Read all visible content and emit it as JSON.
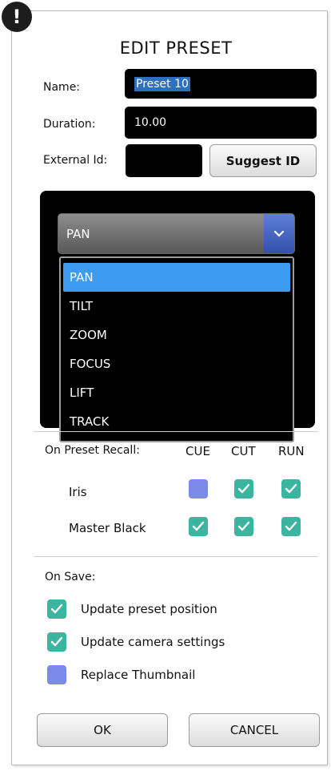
{
  "dialog": {
    "title": "EDIT PRESET",
    "alert_glyph": "!"
  },
  "form": {
    "name_label": "Name:",
    "name_value": "Preset 10",
    "duration_label": "Duration:",
    "duration_value": "10.00",
    "external_id_label": "External Id:",
    "external_id_value": "",
    "suggest_id_label": "Suggest ID"
  },
  "axis_select": {
    "selected": "PAN",
    "options": [
      "PAN",
      "TILT",
      "ZOOM",
      "FOCUS",
      "LIFT",
      "TRACK"
    ]
  },
  "recall": {
    "label": "On Preset Recall:",
    "columns": [
      "CUE",
      "CUT",
      "RUN"
    ],
    "rows": [
      {
        "label": "Iris",
        "values": [
          false,
          true,
          true
        ]
      },
      {
        "label": "Master Black",
        "values": [
          true,
          true,
          true
        ]
      }
    ]
  },
  "save": {
    "label": "On Save:",
    "options": [
      {
        "label": "Update preset position",
        "checked": true
      },
      {
        "label": "Update camera settings",
        "checked": true
      },
      {
        "label": "Replace Thumbnail",
        "checked": false
      }
    ]
  },
  "buttons": {
    "ok": "OK",
    "cancel": "CANCEL"
  },
  "colors": {
    "check_on": "#3bb5a0",
    "check_off": "#7b8ae8",
    "dropdown_highlight": "#3e9bf2",
    "combo_arrow": "#3450aa"
  },
  "icons": {
    "alert": "exclamation-icon",
    "dropdown": "chevron-down-icon",
    "check": "checkmark-icon"
  }
}
